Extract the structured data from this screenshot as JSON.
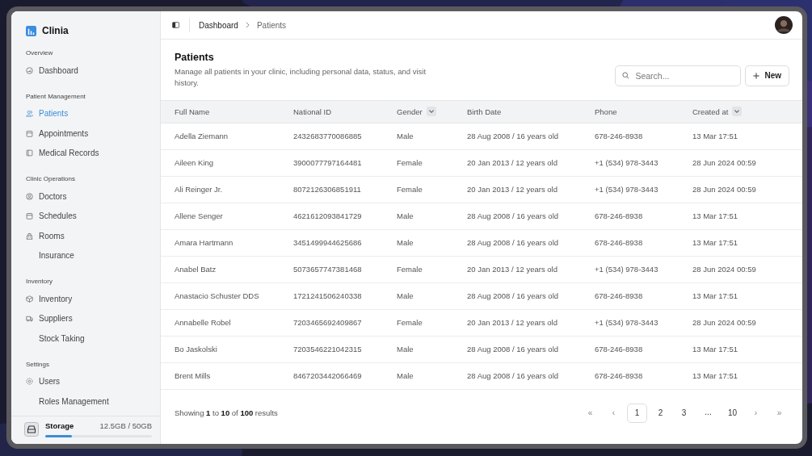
{
  "sidebar": {
    "brand": "Clinia",
    "sections": [
      {
        "title": "Overview",
        "items": [
          {
            "label": "Dashboard",
            "kind": "gauge",
            "selected": false
          }
        ]
      },
      {
        "title": "Patient Management",
        "items": [
          {
            "label": "Patients",
            "kind": "users",
            "selected": true
          },
          {
            "label": "Appointments",
            "kind": "calendar",
            "selected": false
          },
          {
            "label": "Medical Records",
            "kind": "book",
            "selected": false
          }
        ]
      },
      {
        "title": "Clinic Operations",
        "items": [
          {
            "label": "Doctors",
            "kind": "person",
            "selected": false
          },
          {
            "label": "Schedules",
            "kind": "calendar",
            "selected": false
          },
          {
            "label": "Rooms",
            "kind": "building",
            "selected": false
          },
          {
            "label": "Insurance",
            "kind": "plain",
            "selected": false
          }
        ]
      },
      {
        "title": "Inventory",
        "items": [
          {
            "label": "Inventory",
            "kind": "box",
            "selected": false
          },
          {
            "label": "Suppliers",
            "kind": "truck",
            "selected": false
          },
          {
            "label": "Stock Taking",
            "kind": "plain",
            "selected": false
          }
        ]
      },
      {
        "title": "Settings",
        "items": [
          {
            "label": "Users",
            "kind": "gear",
            "selected": false
          },
          {
            "label": "Roles Management",
            "kind": "plain",
            "selected": false
          }
        ]
      }
    ],
    "storage": {
      "label": "Storage",
      "reading": "12.5GB / 50GB",
      "level": 0.25
    }
  },
  "breadcrumb": [
    "Dashboard",
    "Patients"
  ],
  "page": {
    "title": "Patients",
    "description": "Manage all patients in your clinic, including personal data, status, and visit history."
  },
  "search": {
    "placeholder": "Search..."
  },
  "new_button": "New",
  "table": {
    "columns": [
      {
        "label": "Full Name",
        "sortable": false
      },
      {
        "label": "National ID",
        "sortable": false
      },
      {
        "label": "Gender",
        "sortable": true
      },
      {
        "label": "Birth Date",
        "sortable": false
      },
      {
        "label": "Phone",
        "sortable": false
      },
      {
        "label": "Created at",
        "sortable": true
      }
    ],
    "rows": [
      [
        "Adella Ziemann",
        "2432683770086885",
        "Male",
        "28 Aug 2008 / 16 years old",
        "678-246-8938",
        "13 Mar 17:51"
      ],
      [
        "Aileen King",
        "3900077797164481",
        "Female",
        "20 Jan 2013 / 12 years old",
        "+1 (534) 978-3443",
        "28 Jun 2024 00:59"
      ],
      [
        "Ali Reinger Jr.",
        "8072126306851911",
        "Female",
        "20 Jan 2013 / 12 years old",
        "+1 (534) 978-3443",
        "28 Jun 2024 00:59"
      ],
      [
        "Allene Senger",
        "4621612093841729",
        "Male",
        "28 Aug 2008 / 16 years old",
        "678-246-8938",
        "13 Mar 17:51"
      ],
      [
        "Amara Hartmann",
        "3451499944625686",
        "Male",
        "28 Aug 2008 / 16 years old",
        "678-246-8938",
        "13 Mar 17:51"
      ],
      [
        "Anabel Batz",
        "5073657747381468",
        "Female",
        "20 Jan 2013 / 12 years old",
        "+1 (534) 978-3443",
        "28 Jun 2024 00:59"
      ],
      [
        "Anastacio Schuster DDS",
        "1721241506240338",
        "Male",
        "28 Aug 2008 / 16 years old",
        "678-246-8938",
        "13 Mar 17:51"
      ],
      [
        "Annabelle Robel",
        "7203465692409867",
        "Female",
        "20 Jan 2013 / 12 years old",
        "+1 (534) 978-3443",
        "28 Jun 2024 00:59"
      ],
      [
        "Bo Jaskolski",
        "7203546221042315",
        "Male",
        "28 Aug 2008 / 16 years old",
        "678-246-8938",
        "13 Mar 17:51"
      ],
      [
        "Brent Mills",
        "8467203442066469",
        "Male",
        "28 Aug 2008 / 16 years old",
        "678-246-8938",
        "13 Mar 17:51"
      ]
    ]
  },
  "footer": {
    "summary": "Showing **1** to **10** of **100** results",
    "pages": [
      {
        "label": "«",
        "kind": "nav"
      },
      {
        "label": "‹",
        "kind": "nav"
      },
      {
        "label": "1",
        "kind": "page",
        "selected": true
      },
      {
        "label": "2",
        "kind": "page",
        "selected": false
      },
      {
        "label": "3",
        "kind": "page",
        "selected": false
      },
      {
        "label": "...",
        "kind": "ellipsis"
      },
      {
        "label": "10",
        "kind": "page",
        "selected": false
      },
      {
        "label": "›",
        "kind": "nav"
      },
      {
        "label": "»",
        "kind": "nav"
      }
    ]
  }
}
